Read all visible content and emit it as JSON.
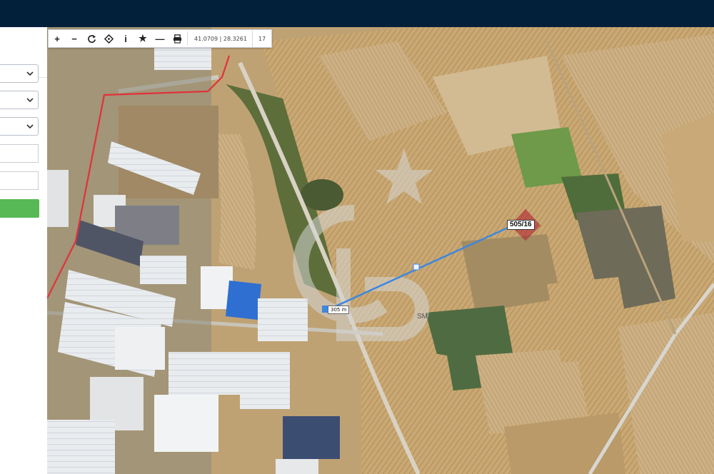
{
  "app": {
    "accent": "#03203b",
    "button_color": "#56b956"
  },
  "side_panel": {
    "selects": [
      {
        "value": ""
      },
      {
        "value": ""
      },
      {
        "value": ""
      }
    ],
    "inputs": [
      {
        "value": ""
      },
      {
        "value": ""
      }
    ],
    "action_button": {
      "label": ""
    }
  },
  "map": {
    "toolbar": {
      "tools": [
        {
          "name": "zoom-in",
          "glyph": "+"
        },
        {
          "name": "zoom-out",
          "glyph": "−"
        },
        {
          "name": "refresh",
          "glyph": "refresh-icon"
        },
        {
          "name": "locate",
          "glyph": "crosshair-icon"
        },
        {
          "name": "info",
          "glyph": "i"
        },
        {
          "name": "favorite",
          "glyph": "★"
        },
        {
          "name": "measure",
          "glyph": "—"
        },
        {
          "name": "print",
          "glyph": "print-icon"
        }
      ],
      "coordinates": "41.0709 | 28.3261",
      "zoom_level": "17"
    },
    "parcel_label": "505/16",
    "distance_label": "305 m",
    "watermark_mark": "SM",
    "colors": {
      "parcel_outline": "#b01c2e",
      "measure_line": "#3d87e0",
      "boundary_line": "#e0323c"
    }
  }
}
